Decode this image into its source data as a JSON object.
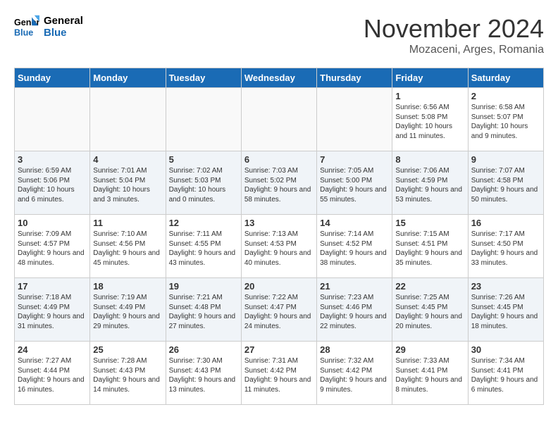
{
  "header": {
    "logo_line1": "General",
    "logo_line2": "Blue",
    "month": "November 2024",
    "location": "Mozaceni, Arges, Romania"
  },
  "weekdays": [
    "Sunday",
    "Monday",
    "Tuesday",
    "Wednesday",
    "Thursday",
    "Friday",
    "Saturday"
  ],
  "weeks": [
    [
      {
        "day": "",
        "info": ""
      },
      {
        "day": "",
        "info": ""
      },
      {
        "day": "",
        "info": ""
      },
      {
        "day": "",
        "info": ""
      },
      {
        "day": "",
        "info": ""
      },
      {
        "day": "1",
        "info": "Sunrise: 6:56 AM\nSunset: 5:08 PM\nDaylight: 10 hours and 11 minutes."
      },
      {
        "day": "2",
        "info": "Sunrise: 6:58 AM\nSunset: 5:07 PM\nDaylight: 10 hours and 9 minutes."
      }
    ],
    [
      {
        "day": "3",
        "info": "Sunrise: 6:59 AM\nSunset: 5:06 PM\nDaylight: 10 hours and 6 minutes."
      },
      {
        "day": "4",
        "info": "Sunrise: 7:01 AM\nSunset: 5:04 PM\nDaylight: 10 hours and 3 minutes."
      },
      {
        "day": "5",
        "info": "Sunrise: 7:02 AM\nSunset: 5:03 PM\nDaylight: 10 hours and 0 minutes."
      },
      {
        "day": "6",
        "info": "Sunrise: 7:03 AM\nSunset: 5:02 PM\nDaylight: 9 hours and 58 minutes."
      },
      {
        "day": "7",
        "info": "Sunrise: 7:05 AM\nSunset: 5:00 PM\nDaylight: 9 hours and 55 minutes."
      },
      {
        "day": "8",
        "info": "Sunrise: 7:06 AM\nSunset: 4:59 PM\nDaylight: 9 hours and 53 minutes."
      },
      {
        "day": "9",
        "info": "Sunrise: 7:07 AM\nSunset: 4:58 PM\nDaylight: 9 hours and 50 minutes."
      }
    ],
    [
      {
        "day": "10",
        "info": "Sunrise: 7:09 AM\nSunset: 4:57 PM\nDaylight: 9 hours and 48 minutes."
      },
      {
        "day": "11",
        "info": "Sunrise: 7:10 AM\nSunset: 4:56 PM\nDaylight: 9 hours and 45 minutes."
      },
      {
        "day": "12",
        "info": "Sunrise: 7:11 AM\nSunset: 4:55 PM\nDaylight: 9 hours and 43 minutes."
      },
      {
        "day": "13",
        "info": "Sunrise: 7:13 AM\nSunset: 4:53 PM\nDaylight: 9 hours and 40 minutes."
      },
      {
        "day": "14",
        "info": "Sunrise: 7:14 AM\nSunset: 4:52 PM\nDaylight: 9 hours and 38 minutes."
      },
      {
        "day": "15",
        "info": "Sunrise: 7:15 AM\nSunset: 4:51 PM\nDaylight: 9 hours and 35 minutes."
      },
      {
        "day": "16",
        "info": "Sunrise: 7:17 AM\nSunset: 4:50 PM\nDaylight: 9 hours and 33 minutes."
      }
    ],
    [
      {
        "day": "17",
        "info": "Sunrise: 7:18 AM\nSunset: 4:49 PM\nDaylight: 9 hours and 31 minutes."
      },
      {
        "day": "18",
        "info": "Sunrise: 7:19 AM\nSunset: 4:49 PM\nDaylight: 9 hours and 29 minutes."
      },
      {
        "day": "19",
        "info": "Sunrise: 7:21 AM\nSunset: 4:48 PM\nDaylight: 9 hours and 27 minutes."
      },
      {
        "day": "20",
        "info": "Sunrise: 7:22 AM\nSunset: 4:47 PM\nDaylight: 9 hours and 24 minutes."
      },
      {
        "day": "21",
        "info": "Sunrise: 7:23 AM\nSunset: 4:46 PM\nDaylight: 9 hours and 22 minutes."
      },
      {
        "day": "22",
        "info": "Sunrise: 7:25 AM\nSunset: 4:45 PM\nDaylight: 9 hours and 20 minutes."
      },
      {
        "day": "23",
        "info": "Sunrise: 7:26 AM\nSunset: 4:45 PM\nDaylight: 9 hours and 18 minutes."
      }
    ],
    [
      {
        "day": "24",
        "info": "Sunrise: 7:27 AM\nSunset: 4:44 PM\nDaylight: 9 hours and 16 minutes."
      },
      {
        "day": "25",
        "info": "Sunrise: 7:28 AM\nSunset: 4:43 PM\nDaylight: 9 hours and 14 minutes."
      },
      {
        "day": "26",
        "info": "Sunrise: 7:30 AM\nSunset: 4:43 PM\nDaylight: 9 hours and 13 minutes."
      },
      {
        "day": "27",
        "info": "Sunrise: 7:31 AM\nSunset: 4:42 PM\nDaylight: 9 hours and 11 minutes."
      },
      {
        "day": "28",
        "info": "Sunrise: 7:32 AM\nSunset: 4:42 PM\nDaylight: 9 hours and 9 minutes."
      },
      {
        "day": "29",
        "info": "Sunrise: 7:33 AM\nSunset: 4:41 PM\nDaylight: 9 hours and 8 minutes."
      },
      {
        "day": "30",
        "info": "Sunrise: 7:34 AM\nSunset: 4:41 PM\nDaylight: 9 hours and 6 minutes."
      }
    ]
  ]
}
